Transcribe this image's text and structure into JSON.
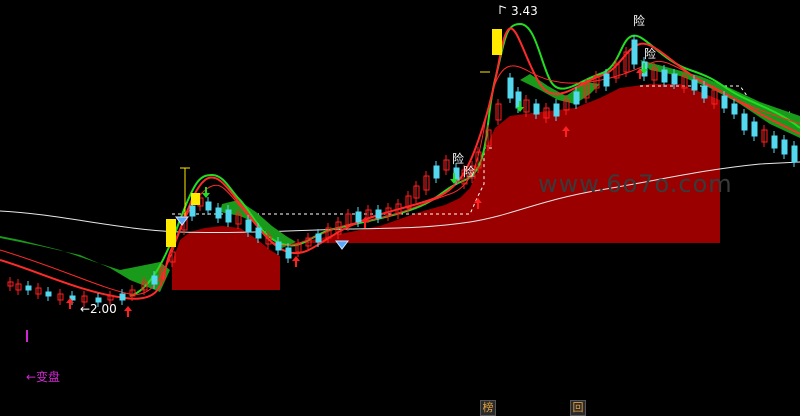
{
  "watermark": "www.6o7o.com",
  "labels": {
    "high_price": "3.43",
    "low_price": "←2.00",
    "change_marker": "←变盘",
    "risk_1": "险",
    "risk_2": "险",
    "risk_3": "险",
    "risk_4": "险"
  },
  "bottom_buttons": [
    "榜",
    "回"
  ],
  "colors": {
    "background": "#000000",
    "up_candle": "#ff2020",
    "down_candle": "#54d8f0",
    "signal_bar": "#ffea00",
    "red_line": "#ff2a2a",
    "green_line": "#22dd22",
    "ribbon": "#1a9a1a",
    "ma_line": "#e8e8e8",
    "block": "#9a0000",
    "dashed_line": "#ffffff",
    "up_arrow": "#ff2020",
    "down_arrow": "#22dd22"
  }
}
